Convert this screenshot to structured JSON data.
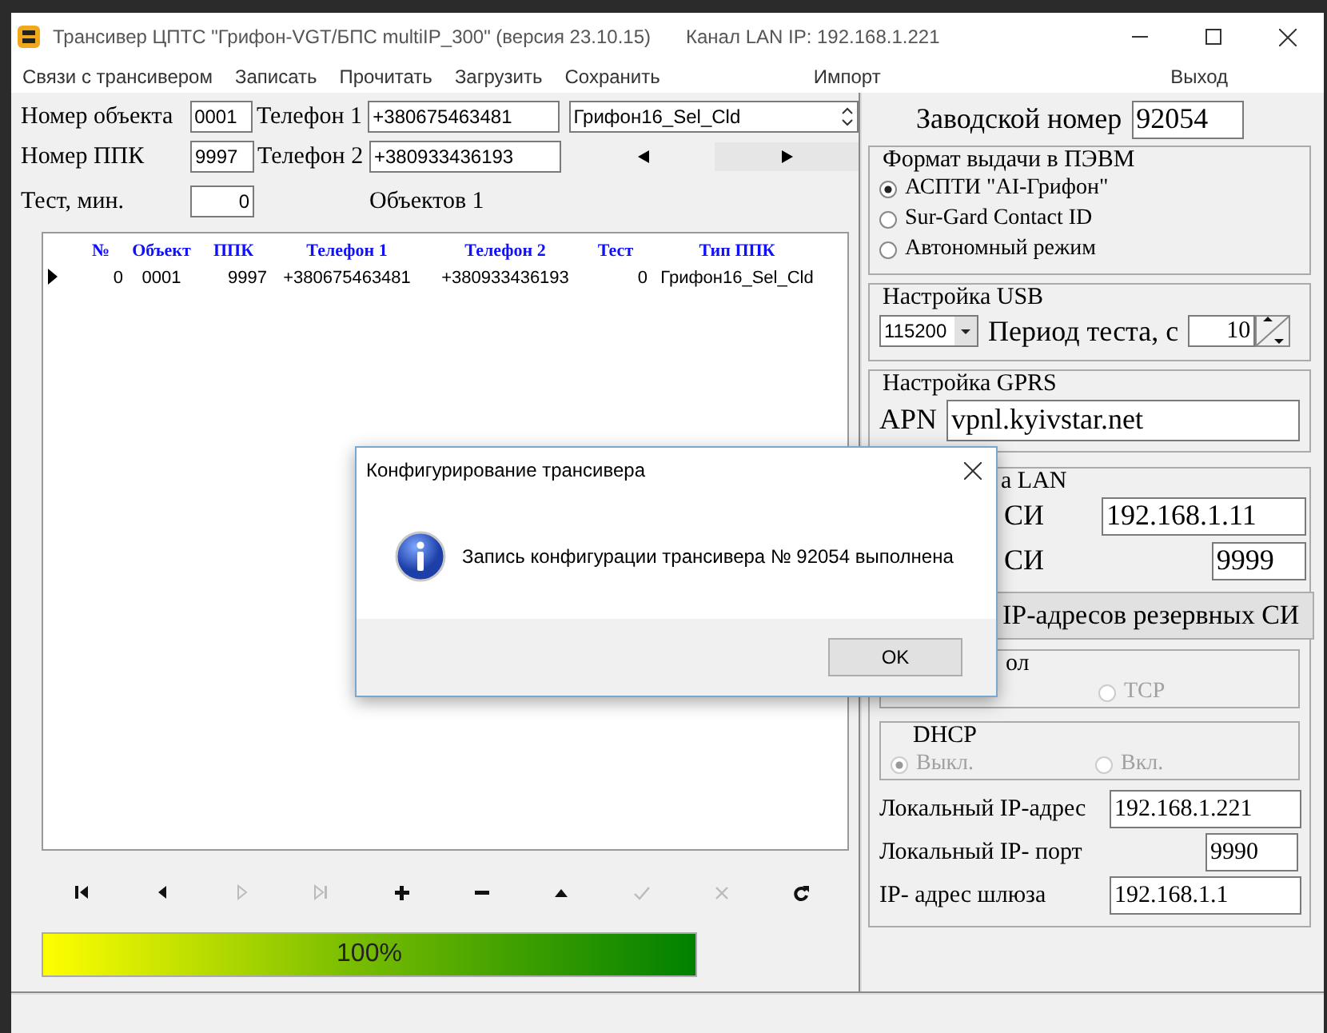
{
  "window": {
    "title": "Трансивер ЦПТС \"Грифон-VGT/БПС multiIP_300\" (версия 23.10.15)",
    "channel": "Канал LAN IP: 192.168.1.221"
  },
  "menu": {
    "items": [
      "Связи с трансивером",
      "Записать",
      "Прочитать",
      "Загрузить",
      "Сохранить"
    ],
    "import": "Импорт",
    "exit": "Выход"
  },
  "object_form": {
    "object_label": "Номер объекта",
    "object_value": "0001",
    "phone1_label": "Телефон 1",
    "phone1_value": "+380675463481",
    "type_value": "Грифон16_Sel_Cld",
    "ppk_label": "Номер ППК",
    "ppk_value": "9997",
    "phone2_label": "Телефон 2",
    "phone2_value": "+380933436193",
    "test_label": "Тест, мин.",
    "test_value": "0",
    "count": "Объектов 1"
  },
  "table": {
    "columns": [
      "№",
      "Объект",
      "ППК",
      "Телефон 1",
      "Телефон 2",
      "Тест",
      "Тип ППК"
    ],
    "rows": [
      {
        "current": true,
        "cells": [
          "0",
          "0001",
          "9997",
          "+380675463481",
          "+380933436193",
          "0",
          "Грифон16_Sel_Cld"
        ]
      }
    ]
  },
  "navigator": [
    {
      "kind": "first",
      "disabled": false
    },
    {
      "kind": "prior",
      "disabled": false
    },
    {
      "kind": "next",
      "disabled": true
    },
    {
      "kind": "last",
      "disabled": true
    },
    {
      "kind": "insert",
      "disabled": false
    },
    {
      "kind": "delete",
      "disabled": false
    },
    {
      "kind": "edit",
      "disabled": false
    },
    {
      "kind": "post",
      "disabled": true
    },
    {
      "kind": "cancel",
      "disabled": true
    },
    {
      "kind": "refresh",
      "disabled": false
    }
  ],
  "progress": {
    "level": 1.0,
    "text": "100%"
  },
  "settings": {
    "serial_label": "Заводской номер",
    "serial_value": "92054",
    "format": {
      "title": "Формат выдачи в ПЭВМ",
      "options": [
        {
          "label": "АСПТИ \"AI-Грифон\"",
          "selected": true
        },
        {
          "label": "Sur-Gard Contact ID",
          "selected": false
        },
        {
          "label": "Автономный режим",
          "selected": false
        }
      ]
    },
    "usb": {
      "title": "Настройка USB",
      "baud": "115200",
      "period_label": "Период теста, с",
      "period_value": "10"
    },
    "gprs": {
      "title": "Настройка GPRS",
      "apn_label": "APN",
      "apn_value": "vpnl.kyivstar.net"
    },
    "lan": {
      "title": "а LAN",
      "server_ip_label": "СИ",
      "server_ip_value": "192.168.1.11",
      "server_port_label": "СИ",
      "server_port_value": "9999",
      "backup_button": "IP-адресов резервных СИ",
      "protocol": {
        "title": "ол",
        "options": [
          {
            "label": "TCP",
            "selected": false,
            "disabled": true
          }
        ]
      },
      "dhcp": {
        "title": "DHCP",
        "options": [
          {
            "label": "Выкл.",
            "selected": true,
            "disabled": true
          },
          {
            "label": "Вкл.",
            "selected": false,
            "disabled": true
          }
        ]
      },
      "local_ip_label": "Локальный IP-адрес",
      "local_ip_value": "192.168.1.221",
      "local_port_label": "Локальный IP- порт",
      "local_port_value": "9990",
      "gateway_label": "IP- адрес шлюза",
      "gateway_value": "192.168.1.1"
    }
  },
  "dialog": {
    "title": "Конфигурирование трансивера",
    "message": "Запись конфигурации трансивера № 92054 выполнена",
    "button": "OK"
  }
}
